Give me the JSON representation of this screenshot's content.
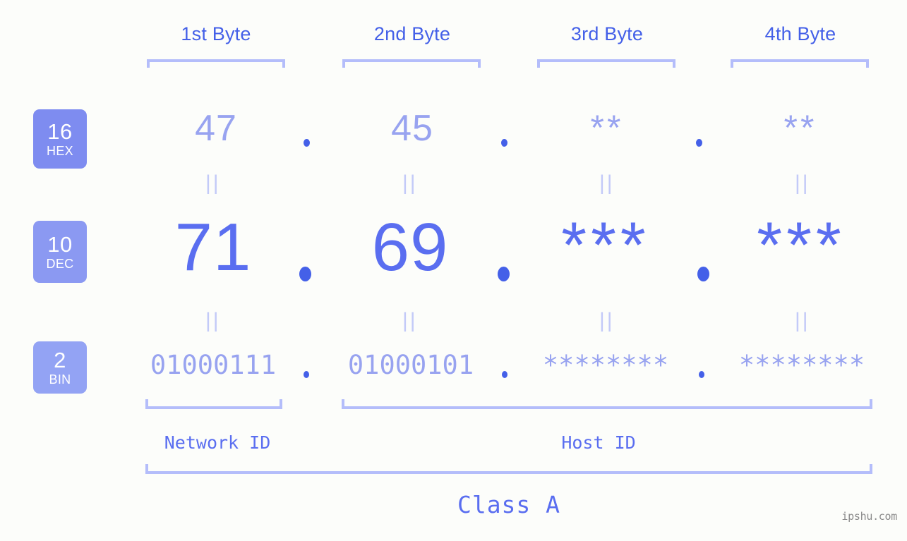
{
  "background": "#fcfdfa",
  "colors": {
    "accent_dark": "#4460e8",
    "accent_mid": "#5a6ef0",
    "accent_light": "#98a3f0",
    "bracket": "#b4bdfa",
    "eqmark": "#c3caf8",
    "badge_hex": "#7e8cf0",
    "badge_dec": "#8b99f2",
    "badge_bin": "#93a3f4",
    "watermark": "#8a8a8a"
  },
  "headers": [
    {
      "label": "1st Byte"
    },
    {
      "label": "2nd Byte"
    },
    {
      "label": "3rd Byte"
    },
    {
      "label": "4th Byte"
    }
  ],
  "bases": [
    {
      "number": "16",
      "name": "HEX"
    },
    {
      "number": "10",
      "name": "DEC"
    },
    {
      "number": "2",
      "name": "BIN"
    }
  ],
  "rows": {
    "hex": {
      "bytes": [
        "47",
        "45",
        "**",
        "**"
      ],
      "separator": "."
    },
    "dec": {
      "bytes": [
        "71",
        "69",
        "***",
        "***"
      ],
      "separator": "."
    },
    "bin": {
      "bytes": [
        "01000111",
        "01000101",
        "********",
        "********"
      ],
      "separator": "."
    }
  },
  "equals_marks": [
    "||",
    "||",
    "||",
    "||",
    "||",
    "||",
    "||",
    "||"
  ],
  "segments": [
    {
      "label": "Network ID"
    },
    {
      "label": "Host ID"
    }
  ],
  "class": {
    "label": "Class A"
  },
  "watermark": {
    "text": "ipshu.com"
  }
}
